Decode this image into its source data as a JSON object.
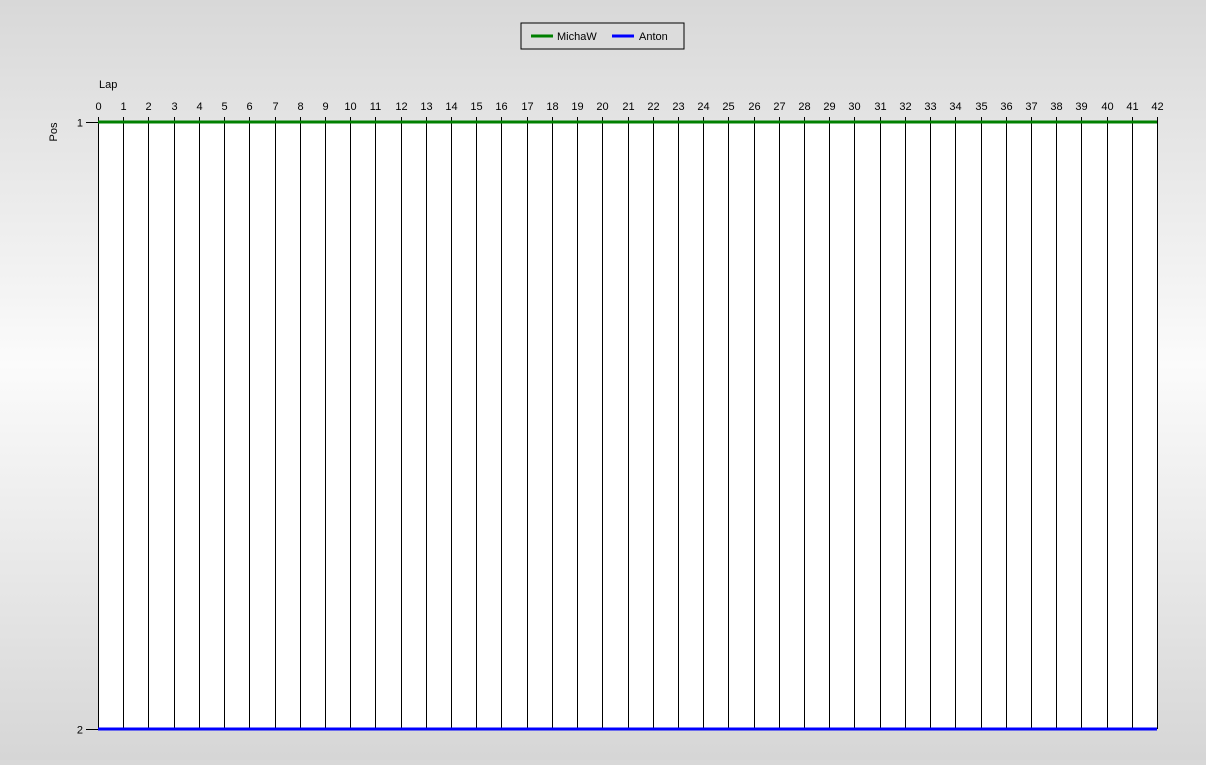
{
  "chart_data": {
    "type": "line",
    "xlabel": "Lap",
    "ylabel": "Pos",
    "x_ticks": [
      0,
      1,
      2,
      3,
      4,
      5,
      6,
      7,
      8,
      9,
      10,
      11,
      12,
      13,
      14,
      15,
      16,
      17,
      18,
      19,
      20,
      21,
      22,
      23,
      24,
      25,
      26,
      27,
      28,
      29,
      30,
      31,
      32,
      33,
      34,
      35,
      36,
      37,
      38,
      39,
      40,
      41,
      42
    ],
    "y_ticks": [
      1,
      2
    ],
    "xlim": [
      0,
      42
    ],
    "ylim": [
      1,
      2
    ],
    "y_inverted": true,
    "x_axis_position": "top",
    "vertical_grid": true,
    "horizontal_grid": false,
    "legend_position": "top-center",
    "series": [
      {
        "name": "MichaW",
        "color": "#008000",
        "x": [
          0,
          1,
          2,
          3,
          4,
          5,
          6,
          7,
          8,
          9,
          10,
          11,
          12,
          13,
          14,
          15,
          16,
          17,
          18,
          19,
          20,
          21,
          22,
          23,
          24,
          25,
          26,
          27,
          28,
          29,
          30,
          31,
          32,
          33,
          34,
          35,
          36,
          37,
          38,
          39,
          40,
          41,
          42
        ],
        "values": [
          1,
          1,
          1,
          1,
          1,
          1,
          1,
          1,
          1,
          1,
          1,
          1,
          1,
          1,
          1,
          1,
          1,
          1,
          1,
          1,
          1,
          1,
          1,
          1,
          1,
          1,
          1,
          1,
          1,
          1,
          1,
          1,
          1,
          1,
          1,
          1,
          1,
          1,
          1,
          1,
          1,
          1,
          1
        ]
      },
      {
        "name": "Anton",
        "color": "#0000ff",
        "x": [
          0,
          1,
          2,
          3,
          4,
          5,
          6,
          7,
          8,
          9,
          10,
          11,
          12,
          13,
          14,
          15,
          16,
          17,
          18,
          19,
          20,
          21,
          22,
          23,
          24,
          25,
          26,
          27,
          28,
          29,
          30,
          31,
          32,
          33,
          34,
          35,
          36,
          37,
          38,
          39,
          40,
          41,
          42
        ],
        "values": [
          2,
          2,
          2,
          2,
          2,
          2,
          2,
          2,
          2,
          2,
          2,
          2,
          2,
          2,
          2,
          2,
          2,
          2,
          2,
          2,
          2,
          2,
          2,
          2,
          2,
          2,
          2,
          2,
          2,
          2,
          2,
          2,
          2,
          2,
          2,
          2,
          2,
          2,
          2,
          2,
          2,
          2,
          2
        ]
      }
    ]
  }
}
